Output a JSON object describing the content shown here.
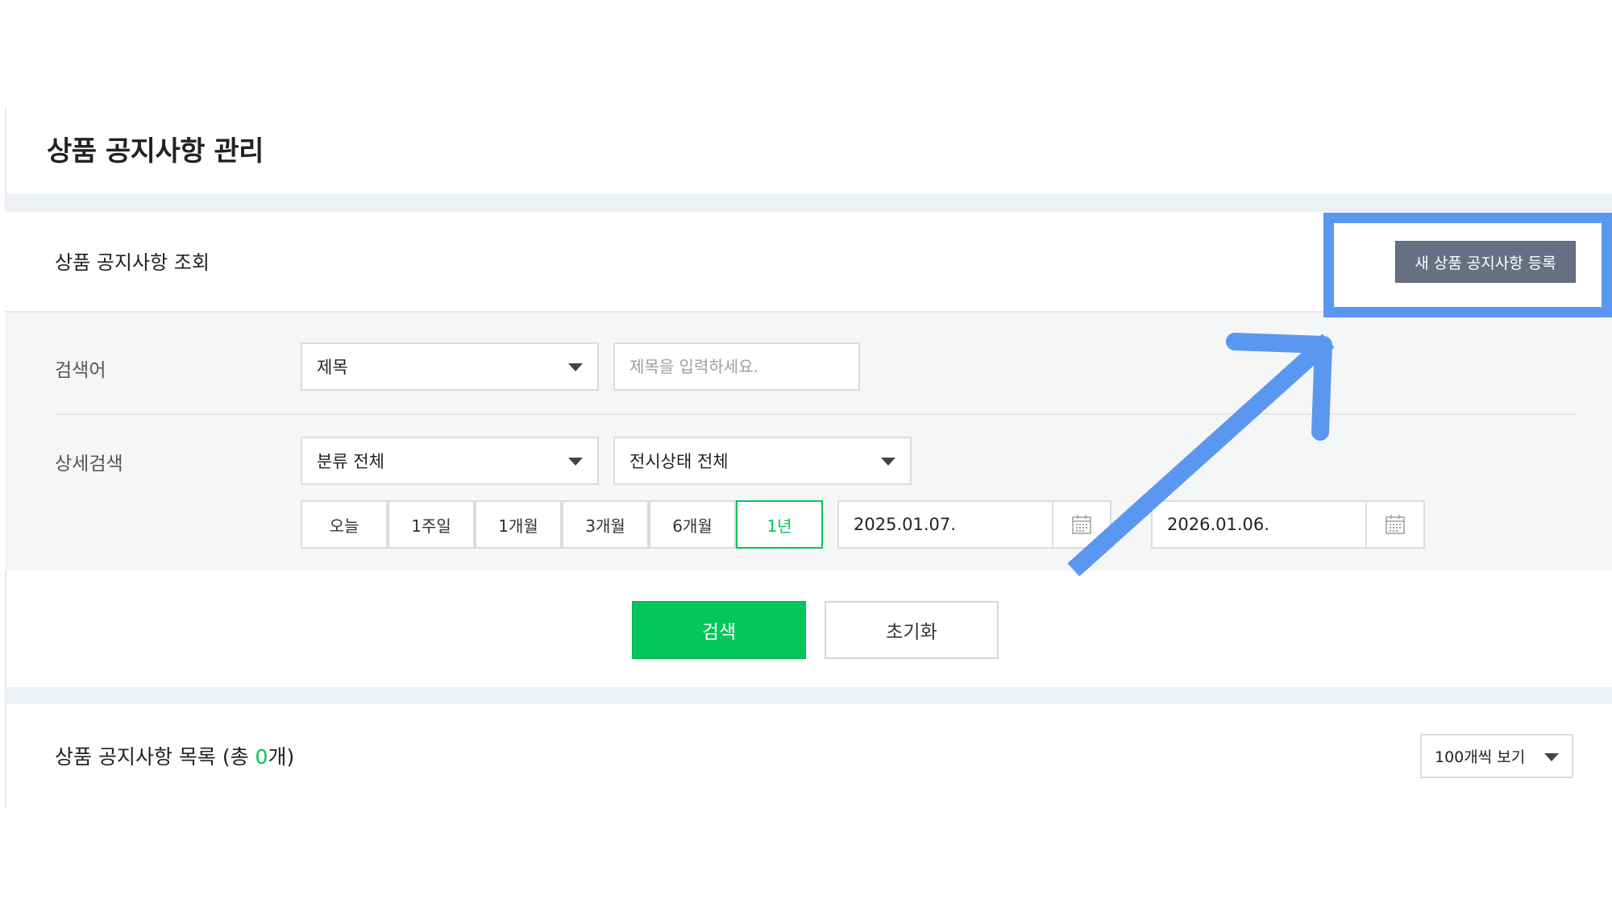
{
  "page": {
    "title": "상품 공지사항 관리"
  },
  "search_section": {
    "title": "상품 공지사항 조회",
    "register_button_label": "새 상품 공지사항 등록",
    "keyword": {
      "label": "검색어",
      "type_selected": "제목",
      "input_placeholder": "제목을 입력하세요.",
      "input_value": ""
    },
    "detail": {
      "label": "상세검색",
      "category_selected": "분류 전체",
      "display_status_selected": "전시상태 전체",
      "period_buttons": [
        "오늘",
        "1주일",
        "1개월",
        "3개월",
        "6개월",
        "1년"
      ],
      "active_period": "1년",
      "start_date": "2025.01.07.",
      "end_date": "2026.01.06."
    },
    "search_button_label": "검색",
    "reset_button_label": "초기화"
  },
  "list_section": {
    "title_prefix": "상품 공지사항 목록 (총 ",
    "total_count": "0",
    "title_suffix": "개)",
    "page_size_selected": "100개씩 보기"
  },
  "annotation": {
    "highlight_color": "#5a97f0"
  },
  "colors": {
    "accent_green": "#03c75a",
    "register_button_bg": "#676f82",
    "filter_background": "#f5f6f8"
  }
}
